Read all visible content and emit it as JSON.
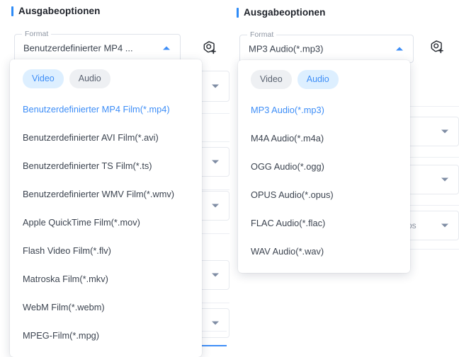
{
  "colors": {
    "accent": "#3e8ef7",
    "accent_bar": "#2e8bf7",
    "pill_active_bg": "#ddefff",
    "pill_inactive_bg": "#eef0f3",
    "text_primary": "#3c4450",
    "text_muted": "#8e96a3",
    "border": "#dfe3ea",
    "surface": "#ffffff"
  },
  "panels": [
    {
      "heading": "Ausgabeoptionen",
      "format_field": {
        "legend": "Format",
        "value": "Benutzerdefinierter MP4 ...",
        "caret_icon": "caret-up-icon",
        "expanded": true
      },
      "add_profile_icon": "add-custom-profile-icon",
      "dropdown": {
        "tabs": [
          {
            "label": "Video",
            "active": true
          },
          {
            "label": "Audio",
            "active": false
          }
        ],
        "options": [
          {
            "label": "Benutzerdefinierter MP4 Film(*.mp4)",
            "selected": true
          },
          {
            "label": "Benutzerdefinierter AVI Film(*.avi)",
            "selected": false
          },
          {
            "label": "Benutzerdefinierter TS Film(*.ts)",
            "selected": false
          },
          {
            "label": "Benutzerdefinierter WMV Film(*.wmv)",
            "selected": false
          },
          {
            "label": "Apple QuickTime Film(*.mov)",
            "selected": false
          },
          {
            "label": "Flash Video Film(*.flv)",
            "selected": false
          },
          {
            "label": "Matroska Film(*.mkv)",
            "selected": false
          },
          {
            "label": "WebM Film(*.webm)",
            "selected": false
          },
          {
            "label": "MPEG-Film(*.mpg)",
            "selected": false
          }
        ]
      }
    },
    {
      "heading": "Ausgabeoptionen",
      "format_field": {
        "legend": "Format",
        "value": "MP3 Audio(*.mp3)",
        "caret_icon": "caret-up-icon",
        "expanded": true
      },
      "add_profile_icon": "add-custom-profile-icon",
      "dropdown": {
        "tabs": [
          {
            "label": "Video",
            "active": false
          },
          {
            "label": "Audio",
            "active": true
          }
        ],
        "options": [
          {
            "label": "MP3 Audio(*.mp3)",
            "selected": true
          },
          {
            "label": "M4A Audio(*.m4a)",
            "selected": false
          },
          {
            "label": "OGG Audio(*.ogg)",
            "selected": false
          },
          {
            "label": "OPUS Audio(*.opus)",
            "selected": false
          },
          {
            "label": "FLAC Audio(*.flac)",
            "selected": false
          },
          {
            "label": "WAV Audio(*.wav)",
            "selected": false
          }
        ]
      }
    }
  ],
  "background": {
    "right_panel_fields": [
      {
        "text": "",
        "caret_icon": "caret-down-icon"
      },
      {
        "text": "",
        "caret_icon": "caret-down-icon"
      },
      {
        "text": "ps",
        "caret_icon": "caret-down-icon"
      }
    ]
  }
}
